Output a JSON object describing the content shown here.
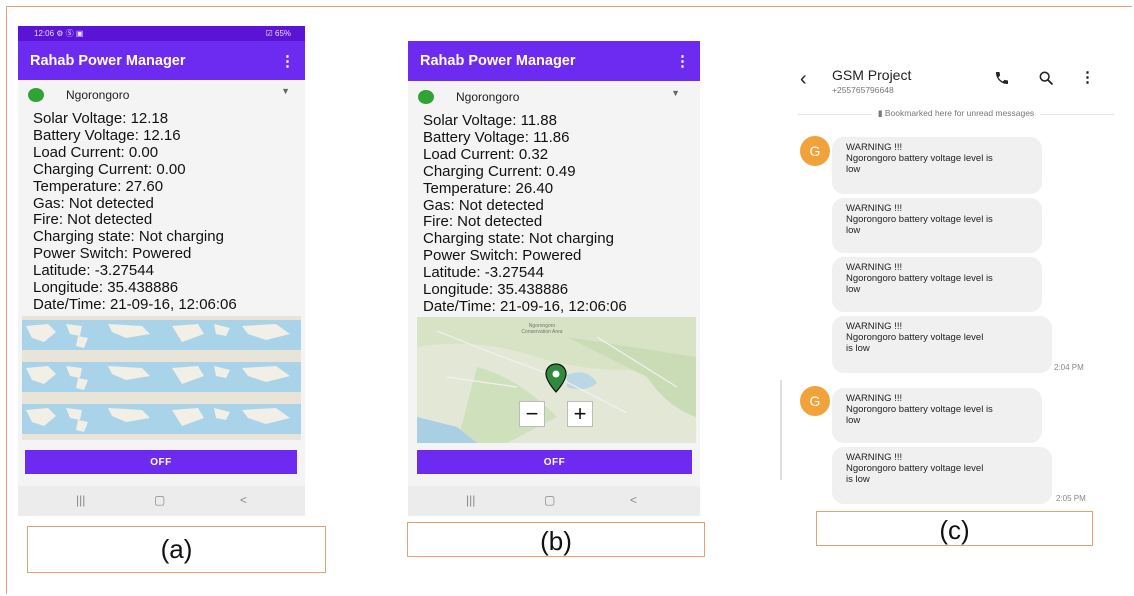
{
  "phone_a": {
    "status_time": "12:06",
    "status_icons": "⚙ Ⓢ ▣",
    "status_right": "☑ 65%",
    "app_title": "Rahab Power Manager",
    "station": "Ngorongoro",
    "readings": [
      "Solar Voltage: 12.18",
      "Battery Voltage: 12.16",
      "Load Current: 0.00",
      "Charging Current: 0.00",
      "Temperature: 27.60",
      "Gas: Not detected",
      "Fire: Not detected",
      "Charging state: Not charging",
      "Power Switch: Powered",
      "Latitude: -3.27544",
      "Longitude: 35.438886",
      "Date/Time: 21-09-16, 12:06:06"
    ],
    "button_label": "OFF"
  },
  "phone_b": {
    "app_title": "Rahab Power Manager",
    "station": "Ngorongoro",
    "readings": [
      "Solar Voltage: 11.88",
      "Battery Voltage: 11.86",
      "Load Current: 0.32",
      "Charging Current: 0.49",
      "Temperature: 26.40",
      "Gas: Not detected",
      "Fire: Not detected",
      "Charging state: Not charging",
      "Power Switch: Powered",
      "Latitude: -3.27544",
      "Longitude: 35.438886",
      "Date/Time: 21-09-16, 12:06:06"
    ],
    "map_label": "Ngorongoro Conservation Area",
    "zoom_out": "−",
    "zoom_in": "+",
    "button_label": "OFF"
  },
  "sms": {
    "contact_name": "GSM Project",
    "contact_number": "+255765796648",
    "bookmark_note": "Bookmarked here for unread messages",
    "avatar_letter": "G",
    "messages": [
      {
        "title": "WARNING !!!",
        "line1": "Ngorongoro battery voltage level is",
        "line2": "low",
        "time": ""
      },
      {
        "title": "WARNING !!!",
        "line1": "Ngorongoro battery voltage level is",
        "line2": "low",
        "time": ""
      },
      {
        "title": "WARNING !!!",
        "line1": "Ngorongoro battery voltage level is",
        "line2": "low",
        "time": ""
      },
      {
        "title": "WARNING !!!",
        "line1": "Ngorongoro battery voltage level",
        "line2": "is low",
        "time": "2:04 PM"
      },
      {
        "title": "WARNING !!!",
        "line1": "Ngorongoro battery voltage level is",
        "line2": "low",
        "time": ""
      },
      {
        "title": "WARNING !!!",
        "line1": "Ngorongoro battery voltage level",
        "line2": "is low",
        "time": "2:05 PM"
      }
    ]
  },
  "captions": {
    "a": "(a)",
    "b": "(b)",
    "c": "(c)"
  },
  "colors": {
    "app_bar": "#6d2af0",
    "status_bar": "#5b14d6",
    "avatar": "#f1a23a",
    "caption_border": "#e3a070"
  }
}
